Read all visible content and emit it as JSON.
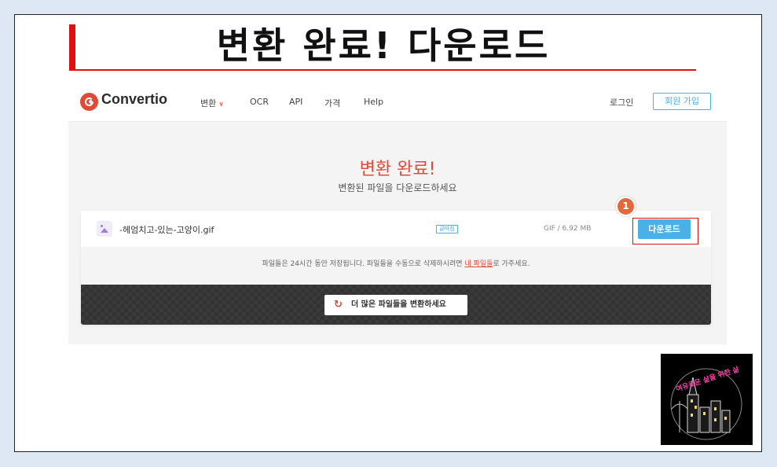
{
  "heading": "변환 완료! 다운로드",
  "nav": {
    "logo": "Convertio",
    "items": [
      {
        "label": "변환",
        "has_dropdown": true
      },
      {
        "label": "OCR"
      },
      {
        "label": "API"
      },
      {
        "label": "가격"
      },
      {
        "label": "Help"
      }
    ],
    "login": "로그인",
    "signup": "회원 가입"
  },
  "result": {
    "title": "변환 완료!",
    "subtitle": "변환된 파일을 다운로드하세요"
  },
  "file": {
    "name": "-헤엄치고-있는-고양이.gif",
    "status": "끝마침",
    "meta": "GIF / 6.92 MB",
    "download_label": "다운로드",
    "step_marker": "1"
  },
  "notice": {
    "prefix": "파일들은 24시간 동안 저장됩니다. 파일들을 수동으로 삭제하시려면 ",
    "link": "내 파일들",
    "suffix": "로 가주세요."
  },
  "more_button": "더 많은 파일들을 변환하세요",
  "icons": {
    "logo": "convertio-logo-icon",
    "dropdown": "chevron-down-icon",
    "file": "image-file-icon",
    "refresh": "refresh-icon"
  },
  "colors": {
    "brand": "#e04b37",
    "accent_blue": "#4ab0e8",
    "highlight_red": "#e01010",
    "step_badge": "#e06a3c"
  }
}
